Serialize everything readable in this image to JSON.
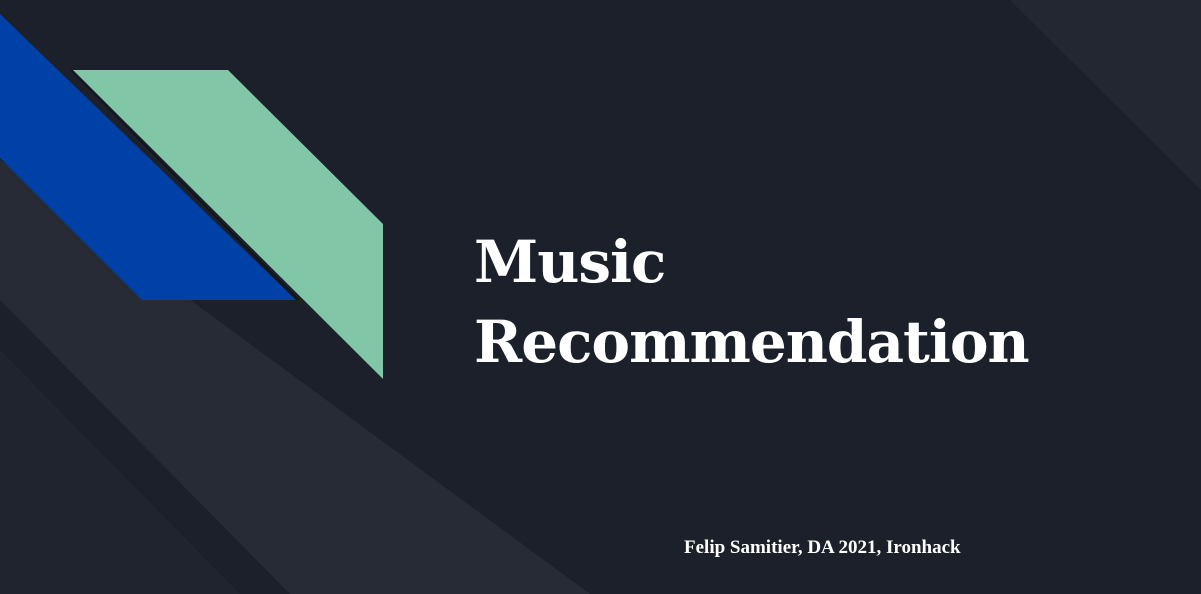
{
  "slide": {
    "title_line1": "Music",
    "title_line2": "Recommendation",
    "subtitle": "Felip Samitier, DA 2021, Ironhack"
  },
  "colors": {
    "background": "#1c202b",
    "band_light": "#262b35",
    "accent_blue": "#0041a8",
    "accent_green": "#81c6a7",
    "text": "#ffffff"
  }
}
